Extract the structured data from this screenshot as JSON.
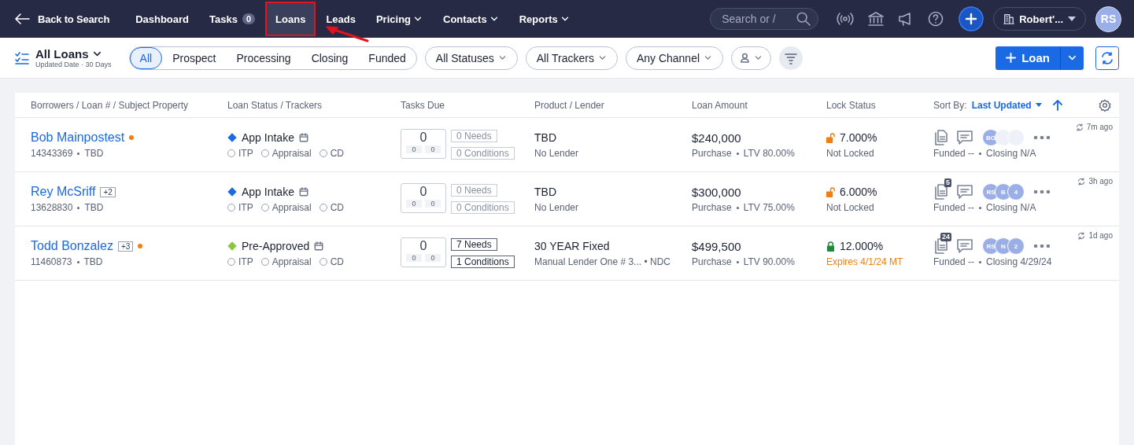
{
  "nav": {
    "back": "Back to Search",
    "items": [
      {
        "label": "Dashboard",
        "selected": false,
        "highlighted": false
      },
      {
        "label": "Tasks",
        "count": "0",
        "selected": false,
        "highlighted": false
      },
      {
        "label": "Loans",
        "selected": true,
        "highlighted": true
      },
      {
        "label": "Leads",
        "selected": false,
        "highlighted": false
      },
      {
        "label": "Pricing",
        "dropdown": true,
        "selected": false,
        "highlighted": false
      },
      {
        "label": "Contacts",
        "dropdown": true,
        "selected": false,
        "highlighted": false
      },
      {
        "label": "Reports",
        "dropdown": true,
        "selected": false,
        "highlighted": false
      }
    ],
    "search": {
      "placeholder": "Search or /"
    },
    "company": "Robert'...",
    "avatar": "RS"
  },
  "toolbar": {
    "view": "All Loans",
    "view_sub": "Updated Date · 30 Days",
    "stages": [
      {
        "label": "All",
        "selected": true
      },
      {
        "label": "Prospect",
        "selected": false
      },
      {
        "label": "Processing",
        "selected": false
      },
      {
        "label": "Closing",
        "selected": false
      },
      {
        "label": "Funded",
        "selected": false
      }
    ],
    "filters": [
      "All Statuses",
      "All Trackers",
      "Any Channel"
    ],
    "new_button": "Loan"
  },
  "table": {
    "columns": [
      "Borrowers / Loan # / Subject Property",
      "Loan Status / Trackers",
      "Tasks Due",
      "Product / Lender",
      "Loan Amount",
      "Lock Status"
    ],
    "sort_label": "Sort By:",
    "sort_value": "Last Updated",
    "rows": [
      {
        "name": "Bob Mainpostest",
        "extra": null,
        "flagged": true,
        "loan_no": "14343369",
        "property": "TBD",
        "status": "App Intake",
        "color": "#1a6ae6",
        "trackers": [
          {
            "label": "ITP",
            "checked": false
          },
          {
            "label": "Appraisal",
            "checked": false
          },
          {
            "label": "CD",
            "checked": false
          }
        ],
        "tasks": "0",
        "tasks_a": "0",
        "tasks_b": "0",
        "needs": {
          "label": "0 Needs",
          "active": false
        },
        "conditions": {
          "label": "0 Conditions",
          "active": false
        },
        "product": "TBD",
        "lender": "No Lender",
        "amount": "$240,000",
        "purpose": "Purchase",
        "ltv": "LTV 80.00%",
        "rate": "7.000%",
        "locked": false,
        "lock_note": "Not Locked",
        "docs": null,
        "avatars": [
          {
            "kind": "initials",
            "text": "BO"
          },
          {
            "kind": "blank"
          },
          {
            "kind": "blank"
          }
        ],
        "funded": "Funded --",
        "closing": "Closing N/A",
        "updated": "7m ago"
      },
      {
        "name": "Rey McSriff",
        "extra": "+2",
        "flagged": false,
        "loan_no": "13628830",
        "property": "TBD",
        "status": "App Intake",
        "color": "#1a6ae6",
        "trackers": [
          {
            "label": "ITP",
            "checked": false
          },
          {
            "label": "Appraisal",
            "checked": false
          },
          {
            "label": "CD",
            "checked": false
          }
        ],
        "tasks": "0",
        "tasks_a": "0",
        "tasks_b": "0",
        "needs": {
          "label": "0 Needs",
          "active": false
        },
        "conditions": {
          "label": "0 Conditions",
          "active": false
        },
        "product": "TBD",
        "lender": "No Lender",
        "amount": "$300,000",
        "purpose": "Purchase",
        "ltv": "LTV 75.00%",
        "rate": "6.000%",
        "locked": false,
        "lock_note": "Not Locked",
        "docs": "5",
        "avatars": [
          {
            "kind": "initials",
            "text": "RS"
          },
          {
            "kind": "initials",
            "text": "B"
          },
          {
            "kind": "initials",
            "text": "4"
          }
        ],
        "funded": "Funded --",
        "closing": "Closing N/A",
        "updated": "3h ago"
      },
      {
        "name": "Todd Bonzalez",
        "extra": "+3",
        "flagged": true,
        "loan_no": "11460873",
        "property": "TBD",
        "status": "Pre-Approved",
        "color": "#8cc63f",
        "trackers": [
          {
            "label": "ITP",
            "checked": false
          },
          {
            "label": "Appraisal",
            "checked": false
          },
          {
            "label": "CD",
            "checked": false
          }
        ],
        "tasks": "0",
        "tasks_a": "0",
        "tasks_b": "0",
        "needs": {
          "label": "7 Needs",
          "active": true
        },
        "conditions": {
          "label": "1 Conditions",
          "active": true
        },
        "product": "30 YEAR Fixed",
        "lender": "Manual Lender One # 3... • NDC",
        "amount": "$499,500",
        "purpose": "Purchase",
        "ltv": "LTV 90.00%",
        "rate": "12.000%",
        "locked": true,
        "lock_note": "Expires 4/1/24 MT",
        "docs": "24",
        "avatars": [
          {
            "kind": "initials",
            "text": "RS"
          },
          {
            "kind": "initials",
            "text": "N"
          },
          {
            "kind": "initials",
            "text": "2"
          }
        ],
        "funded": "Funded --",
        "closing": "Closing 4/29/24",
        "updated": "1d ago"
      }
    ]
  }
}
